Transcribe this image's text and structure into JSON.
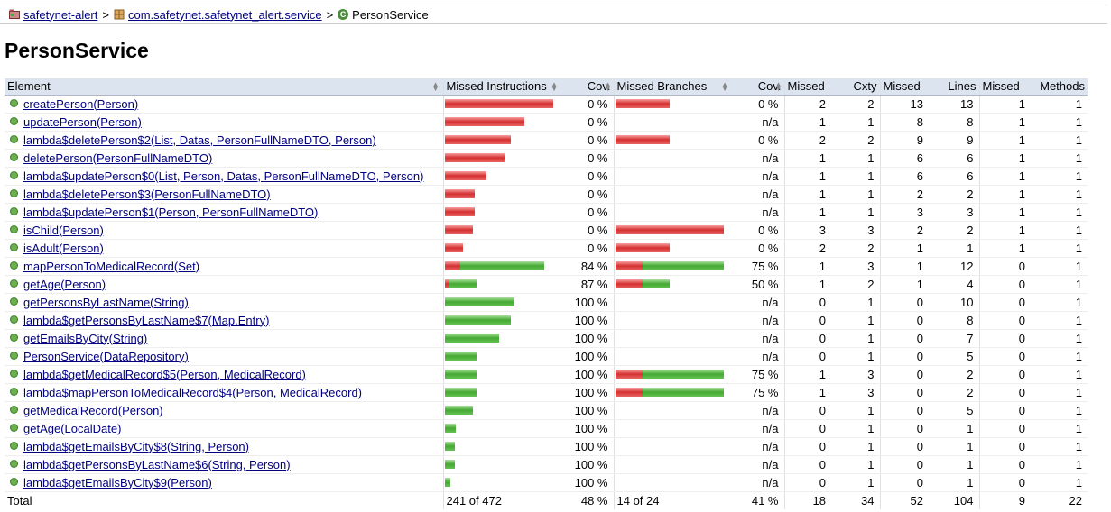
{
  "breadcrumb": {
    "project": "safetynet-alert",
    "package": "com.safetynet.safetynet_alert.service",
    "current": "PersonService",
    "separator": ">"
  },
  "title": "PersonService",
  "colors": {
    "missed": "#d43030",
    "covered": "#44a832",
    "header": "#dce4ef",
    "link": "#000080"
  },
  "columns": [
    "Element",
    "Missed Instructions",
    "Cov.",
    "Missed Branches",
    "Cov.",
    "Missed",
    "Cxty",
    "Missed",
    "Lines",
    "Missed",
    "Methods"
  ],
  "rows": [
    {
      "name": "createPerson(Person)",
      "instr_missed": 1.0,
      "instr_total": 1.0,
      "icov": "0 %",
      "br_missed": 0.5,
      "br_total": 0.5,
      "bcov": "0 %",
      "cmiss": "2",
      "cx": "2",
      "lmiss": "13",
      "lines": "13",
      "mmiss": "1",
      "meth": "1"
    },
    {
      "name": "updatePerson(Person)",
      "instr_missed": 0.733,
      "instr_total": 0.733,
      "icov": "0 %",
      "br_missed": 0,
      "br_total": 0,
      "bcov": "n/a",
      "cmiss": "1",
      "cx": "1",
      "lmiss": "8",
      "lines": "8",
      "mmiss": "1",
      "meth": "1"
    },
    {
      "name": "lambda$deletePerson$2(List, Datas, PersonFullNameDTO, Person)",
      "instr_missed": 0.608,
      "instr_total": 0.608,
      "icov": "0 %",
      "br_missed": 0.5,
      "br_total": 0.5,
      "bcov": "0 %",
      "cmiss": "2",
      "cx": "2",
      "lmiss": "9",
      "lines": "9",
      "mmiss": "1",
      "meth": "1"
    },
    {
      "name": "deletePerson(PersonFullNameDTO)",
      "instr_missed": 0.55,
      "instr_total": 0.55,
      "icov": "0 %",
      "br_missed": 0,
      "br_total": 0,
      "bcov": "n/a",
      "cmiss": "1",
      "cx": "1",
      "lmiss": "6",
      "lines": "6",
      "mmiss": "1",
      "meth": "1"
    },
    {
      "name": "lambda$updatePerson$0(List, Person, Datas, PersonFullNameDTO, Person)",
      "instr_missed": 0.383,
      "instr_total": 0.383,
      "icov": "0 %",
      "br_missed": 0,
      "br_total": 0,
      "bcov": "n/a",
      "cmiss": "1",
      "cx": "1",
      "lmiss": "6",
      "lines": "6",
      "mmiss": "1",
      "meth": "1"
    },
    {
      "name": "lambda$deletePerson$3(PersonFullNameDTO)",
      "instr_missed": 0.275,
      "instr_total": 0.275,
      "icov": "0 %",
      "br_missed": 0,
      "br_total": 0,
      "bcov": "n/a",
      "cmiss": "1",
      "cx": "1",
      "lmiss": "2",
      "lines": "2",
      "mmiss": "1",
      "meth": "1"
    },
    {
      "name": "lambda$updatePerson$1(Person, PersonFullNameDTO)",
      "instr_missed": 0.275,
      "instr_total": 0.275,
      "icov": "0 %",
      "br_missed": 0,
      "br_total": 0,
      "bcov": "n/a",
      "cmiss": "1",
      "cx": "1",
      "lmiss": "3",
      "lines": "3",
      "mmiss": "1",
      "meth": "1"
    },
    {
      "name": "isChild(Person)",
      "instr_missed": 0.258,
      "instr_total": 0.258,
      "icov": "0 %",
      "br_missed": 1.0,
      "br_total": 1.0,
      "bcov": "0 %",
      "cmiss": "3",
      "cx": "3",
      "lmiss": "2",
      "lines": "2",
      "mmiss": "1",
      "meth": "1"
    },
    {
      "name": "isAdult(Person)",
      "instr_missed": 0.167,
      "instr_total": 0.167,
      "icov": "0 %",
      "br_missed": 0.5,
      "br_total": 0.5,
      "bcov": "0 %",
      "cmiss": "2",
      "cx": "2",
      "lmiss": "1",
      "lines": "1",
      "mmiss": "1",
      "meth": "1"
    },
    {
      "name": "mapPersonToMedicalRecord(Set)",
      "instr_missed": 0.142,
      "instr_total": 0.917,
      "icov": "84 %",
      "br_missed": 0.25,
      "br_total": 1.0,
      "bcov": "75 %",
      "cmiss": "1",
      "cx": "3",
      "lmiss": "1",
      "lines": "12",
      "mmiss": "0",
      "meth": "1"
    },
    {
      "name": "getAge(Person)",
      "instr_missed": 0.042,
      "instr_total": 0.292,
      "icov": "87 %",
      "br_missed": 0.25,
      "br_total": 0.5,
      "bcov": "50 %",
      "cmiss": "1",
      "cx": "2",
      "lmiss": "1",
      "lines": "4",
      "mmiss": "0",
      "meth": "1"
    },
    {
      "name": "getPersonsByLastName(String)",
      "instr_missed": 0,
      "instr_total": 0.642,
      "icov": "100 %",
      "br_missed": 0,
      "br_total": 0,
      "bcov": "n/a",
      "cmiss": "0",
      "cx": "1",
      "lmiss": "0",
      "lines": "10",
      "mmiss": "0",
      "meth": "1"
    },
    {
      "name": "lambda$getPersonsByLastName$7(Map.Entry)",
      "instr_missed": 0,
      "instr_total": 0.608,
      "icov": "100 %",
      "br_missed": 0,
      "br_total": 0,
      "bcov": "n/a",
      "cmiss": "0",
      "cx": "1",
      "lmiss": "0",
      "lines": "8",
      "mmiss": "0",
      "meth": "1"
    },
    {
      "name": "getEmailsByCity(String)",
      "instr_missed": 0,
      "instr_total": 0.5,
      "icov": "100 %",
      "br_missed": 0,
      "br_total": 0,
      "bcov": "n/a",
      "cmiss": "0",
      "cx": "1",
      "lmiss": "0",
      "lines": "7",
      "mmiss": "0",
      "meth": "1"
    },
    {
      "name": "PersonService(DataRepository)",
      "instr_missed": 0,
      "instr_total": 0.292,
      "icov": "100 %",
      "br_missed": 0,
      "br_total": 0,
      "bcov": "n/a",
      "cmiss": "0",
      "cx": "1",
      "lmiss": "0",
      "lines": "5",
      "mmiss": "0",
      "meth": "1"
    },
    {
      "name": "lambda$getMedicalRecord$5(Person, MedicalRecord)",
      "instr_missed": 0,
      "instr_total": 0.292,
      "icov": "100 %",
      "br_missed": 0.25,
      "br_total": 1.0,
      "bcov": "75 %",
      "cmiss": "1",
      "cx": "3",
      "lmiss": "0",
      "lines": "2",
      "mmiss": "0",
      "meth": "1"
    },
    {
      "name": "lambda$mapPersonToMedicalRecord$4(Person, MedicalRecord)",
      "instr_missed": 0,
      "instr_total": 0.292,
      "icov": "100 %",
      "br_missed": 0.25,
      "br_total": 1.0,
      "bcov": "75 %",
      "cmiss": "1",
      "cx": "3",
      "lmiss": "0",
      "lines": "2",
      "mmiss": "0",
      "meth": "1"
    },
    {
      "name": "getMedicalRecord(Person)",
      "instr_missed": 0,
      "instr_total": 0.258,
      "icov": "100 %",
      "br_missed": 0,
      "br_total": 0,
      "bcov": "n/a",
      "cmiss": "0",
      "cx": "1",
      "lmiss": "0",
      "lines": "5",
      "mmiss": "0",
      "meth": "1"
    },
    {
      "name": "getAge(LocalDate)",
      "instr_missed": 0,
      "instr_total": 0.1,
      "icov": "100 %",
      "br_missed": 0,
      "br_total": 0,
      "bcov": "n/a",
      "cmiss": "0",
      "cx": "1",
      "lmiss": "0",
      "lines": "1",
      "mmiss": "0",
      "meth": "1"
    },
    {
      "name": "lambda$getEmailsByCity$8(String, Person)",
      "instr_missed": 0,
      "instr_total": 0.092,
      "icov": "100 %",
      "br_missed": 0,
      "br_total": 0,
      "bcov": "n/a",
      "cmiss": "0",
      "cx": "1",
      "lmiss": "0",
      "lines": "1",
      "mmiss": "0",
      "meth": "1"
    },
    {
      "name": "lambda$getPersonsByLastName$6(String, Person)",
      "instr_missed": 0,
      "instr_total": 0.092,
      "icov": "100 %",
      "br_missed": 0,
      "br_total": 0,
      "bcov": "n/a",
      "cmiss": "0",
      "cx": "1",
      "lmiss": "0",
      "lines": "1",
      "mmiss": "0",
      "meth": "1"
    },
    {
      "name": "lambda$getEmailsByCity$9(Person)",
      "instr_missed": 0,
      "instr_total": 0.05,
      "icov": "100 %",
      "br_missed": 0,
      "br_total": 0,
      "bcov": "n/a",
      "cmiss": "0",
      "cx": "1",
      "lmiss": "0",
      "lines": "1",
      "mmiss": "0",
      "meth": "1"
    }
  ],
  "total": {
    "label": "Total",
    "instr": "241 of 472",
    "icov": "48 %",
    "br": "14 of 24",
    "bcov": "41 %",
    "cmiss": "18",
    "cx": "34",
    "lmiss": "52",
    "lines": "104",
    "mmiss": "9",
    "meth": "22"
  }
}
